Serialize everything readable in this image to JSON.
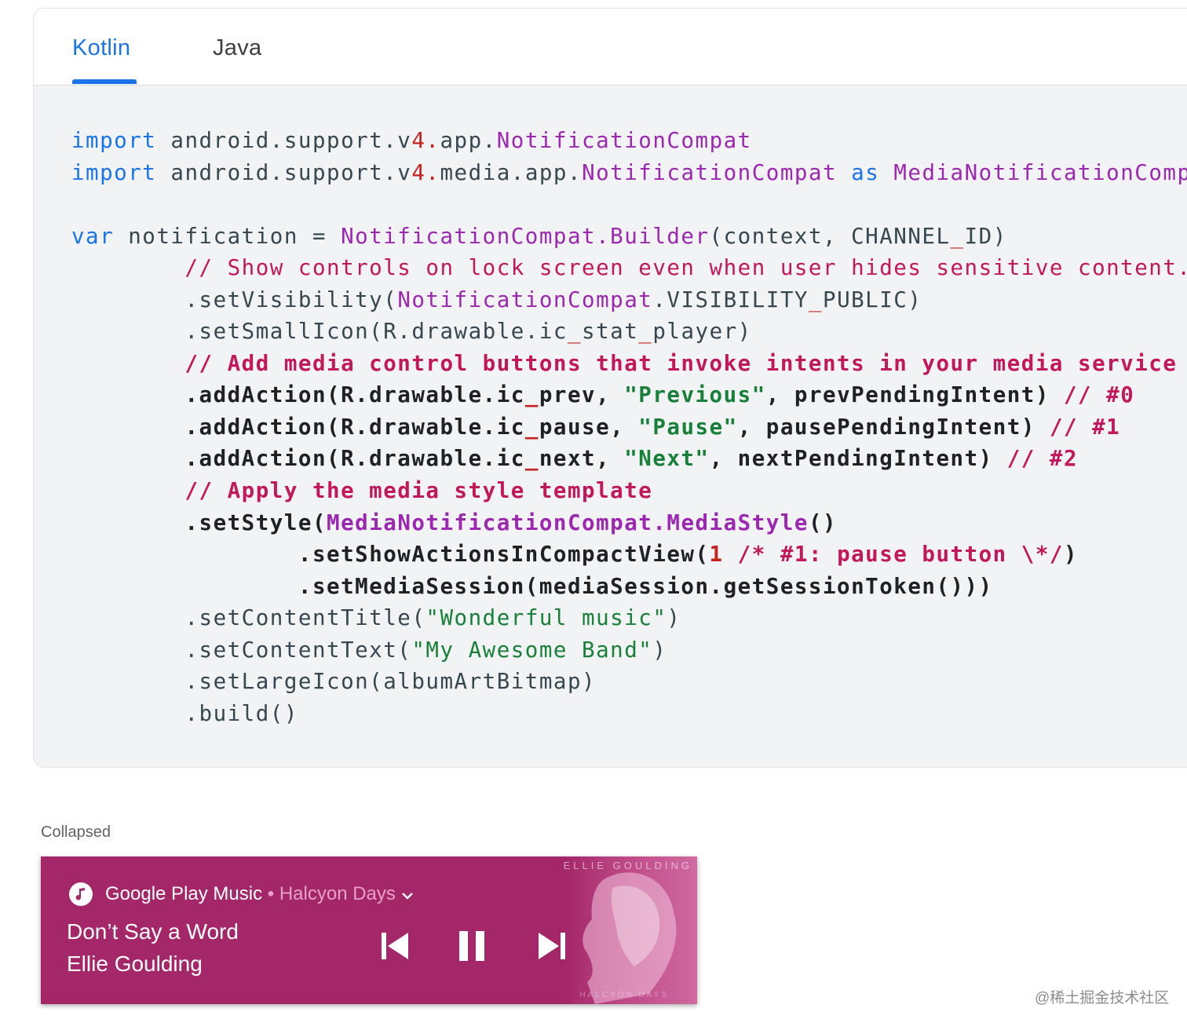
{
  "tabs": [
    {
      "label": "Kotlin",
      "active": true
    },
    {
      "label": "Java",
      "active": false
    }
  ],
  "code": {
    "import_kw": "import",
    "as_kw": "as",
    "var_kw": "var",
    "comment_show": "// Show controls on lock screen even when user hides sensitive content.",
    "comment_add": "// Add media control buttons that invoke intents in your media service",
    "comment_apply": "// Apply the media style template",
    "comment_compact": "/* #1: pause button \\*/",
    "str_previous": "\"Previous\"",
    "str_pause": "\"Pause\"",
    "str_next": "\"Next\"",
    "str_title": "\"Wonderful music\"",
    "str_text": "\"My Awesome Band\""
  },
  "collapsed_label": "Collapsed",
  "notification": {
    "app_name": "Google Play Music",
    "separator": "•",
    "album": "Halcyon Days",
    "song_title": "Don’t Say a Word",
    "artist": "Ellie Goulding",
    "art_text_top": "ELLIE GOULDING",
    "art_text_bottom": "HALCYON DAYS",
    "colors": {
      "background": "#a4276a",
      "subtext": "#e7a0c8"
    },
    "icons": [
      "music-note-icon",
      "chevron-down-icon",
      "skip-previous-icon",
      "pause-icon",
      "skip-next-icon"
    ]
  },
  "watermark": "@稀土掘金技术社区",
  "colors": {
    "accent": "#1a73e8",
    "keyword": "#1a73e8",
    "type": "#9c27b0",
    "comment": "#c2185b",
    "string": "#188038",
    "number": "#c5221f"
  }
}
